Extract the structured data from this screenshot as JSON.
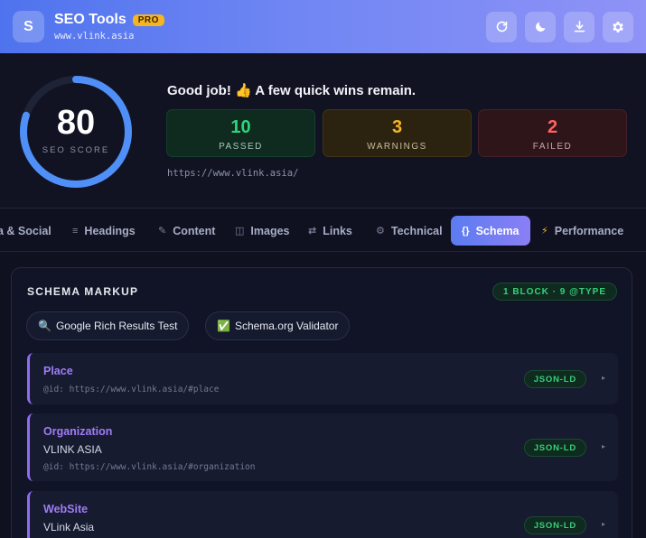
{
  "header": {
    "logo_letter": "S",
    "title": "SEO Tools",
    "badge": "PRO",
    "url": "www.vlink.asia",
    "actions": [
      "refresh-icon",
      "moon-icon",
      "download-icon",
      "gear-icon"
    ]
  },
  "score": {
    "value": "80",
    "percent": 80,
    "label": "SEO SCORE",
    "summary": "Good job! 👍 A few quick wins remain.",
    "stats": {
      "passed": {
        "value": "10",
        "label": "PASSED"
      },
      "warnings": {
        "value": "3",
        "label": "WARNINGS"
      },
      "failed": {
        "value": "2",
        "label": "FAILED"
      }
    },
    "page_url": "https://www.vlink.asia/"
  },
  "tabs": [
    {
      "label": "a & Social",
      "icon": ""
    },
    {
      "label": "Headings",
      "icon": "≡"
    },
    {
      "label": "Content",
      "icon": "✎"
    },
    {
      "label": "Images",
      "icon": "◫"
    },
    {
      "label": "Links",
      "icon": "⇄"
    },
    {
      "label": "Technical",
      "icon": "⚙"
    },
    {
      "label": "Schema",
      "icon": "{}"
    },
    {
      "label": "Performance",
      "icon": "⚡"
    }
  ],
  "schema": {
    "title": "SCHEMA MARKUP",
    "count": "1 BLOCK · 9 @TYPE",
    "tools": [
      {
        "emoji": "🔍",
        "label": "Google Rich Results Test"
      },
      {
        "emoji": "✅",
        "label": "Schema.org Validator"
      }
    ],
    "items": [
      {
        "type": "Place",
        "name": "",
        "id": "@id: https://www.vlink.asia/#place",
        "format": "JSON-LD"
      },
      {
        "type": "Organization",
        "name": "VLINK ASIA",
        "id": "@id: https://www.vlink.asia/#organization",
        "format": "JSON-LD"
      },
      {
        "type": "WebSite",
        "name": "VLink Asia",
        "id": "",
        "format": "JSON-LD"
      }
    ]
  },
  "colors": {
    "accent": "#5b7cf0",
    "passed": "#2ed47a",
    "warning": "#f5b523",
    "failed": "#ff6262",
    "schema_type": "#a07cf7"
  }
}
